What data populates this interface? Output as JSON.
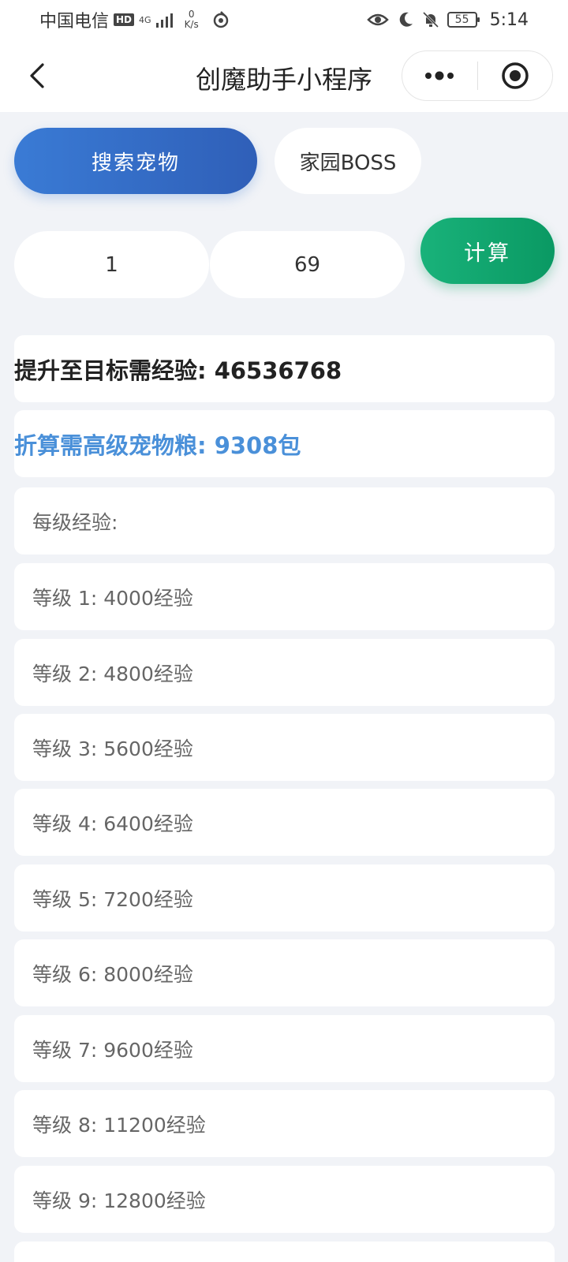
{
  "status_bar": {
    "carrier": "中国电信",
    "hd": "HD",
    "network": "4G",
    "speed_value": "0",
    "speed_unit": "K/s",
    "battery": "55",
    "time": "5:14"
  },
  "nav": {
    "title": "创魔助手小程序"
  },
  "tabs": [
    {
      "label": "搜索宠物",
      "active": true
    },
    {
      "label": "家园BOSS",
      "active": false
    }
  ],
  "inputs": {
    "start_level": "1",
    "target_level": "69"
  },
  "calculate_label": "计算",
  "result": {
    "total_exp": "提升至目标需经验: 46536768",
    "food": "折算需高级宠物粮: 9308包"
  },
  "per_level_header": "每级经验:",
  "levels": [
    "等级 1: 4000经验",
    "等级 2: 4800经验",
    "等级 3: 5600经验",
    "等级 4: 6400经验",
    "等级 5: 7200经验",
    "等级 6: 8000经验",
    "等级 7: 9600经验",
    "等级 8: 11200经验",
    "等级 9: 12800经验"
  ],
  "colors": {
    "tab_active": "#3a7bd5",
    "calc_button": "#0a9963",
    "food_text": "#4a90d9",
    "background": "#f1f3f7"
  }
}
